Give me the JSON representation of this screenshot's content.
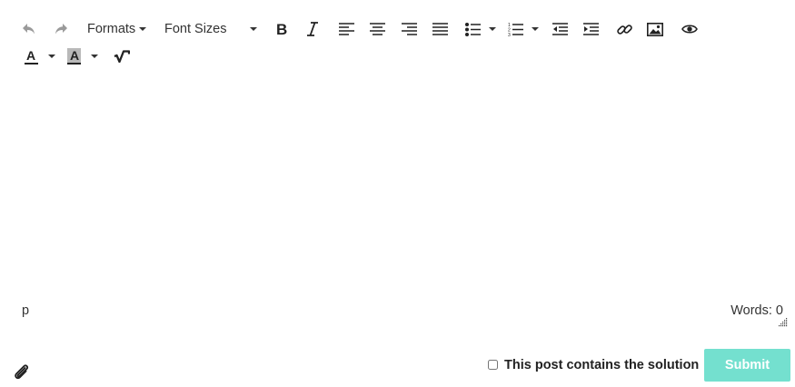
{
  "toolbar": {
    "row1": [
      {
        "name": "undo-icon",
        "label": "Undo"
      },
      {
        "name": "redo-icon",
        "label": "Redo"
      }
    ],
    "formats_label": "Formats",
    "font_sizes_label": "Font Sizes",
    "icons": [
      "bold-icon",
      "italic-icon",
      "align-left-icon",
      "align-center-icon",
      "align-right-icon",
      "align-justify-icon",
      "bullet-list-icon",
      "numbered-list-icon",
      "outdent-icon",
      "indent-icon",
      "link-icon",
      "image-icon",
      "preview-icon",
      "text-color-icon",
      "background-color-icon",
      "math-icon"
    ],
    "text_color_glyph": "A",
    "bg_color_glyph": "A"
  },
  "editor": {
    "content": "",
    "status_path": "p",
    "word_count": "Words: 0"
  },
  "footer": {
    "solution_label": "This post contains the solution",
    "solution_checked": false,
    "submit_label": "Submit"
  },
  "colors": {
    "submit_bg": "#74e0cf",
    "icon": "#222222",
    "disabled_icon": "#9a9a9a"
  }
}
